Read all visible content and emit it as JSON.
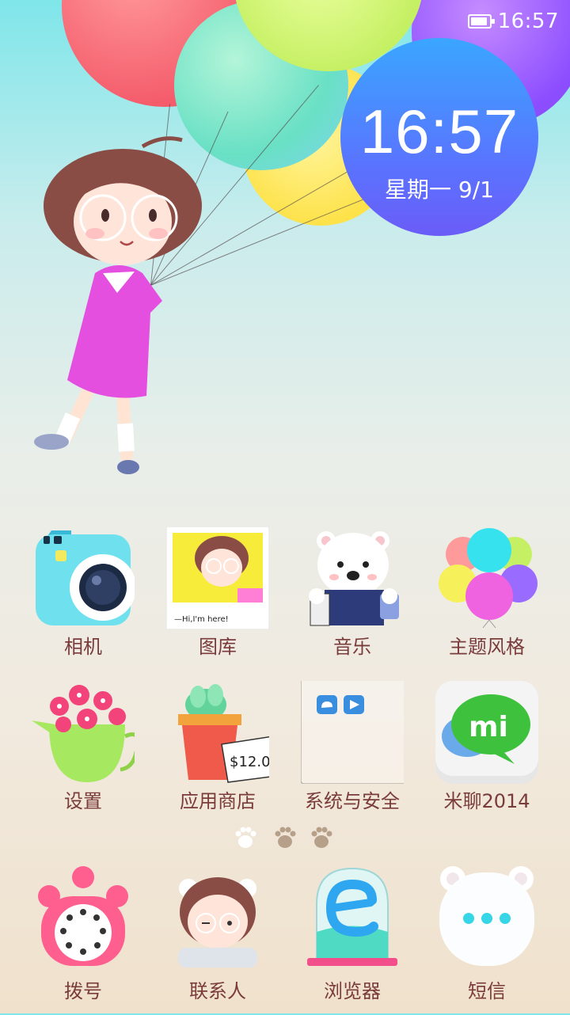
{
  "status_bar": {
    "time": "16:57",
    "battery_icon": "battery-icon",
    "battery_level": 0.9
  },
  "clock_widget": {
    "time": "16:57",
    "date": "星期一 9/1"
  },
  "apps": [
    {
      "label": "相机",
      "icon": "camera-icon"
    },
    {
      "label": "图库",
      "icon": "gallery-icon"
    },
    {
      "label": "音乐",
      "icon": "music-icon"
    },
    {
      "label": "主题风格",
      "icon": "theme-icon"
    },
    {
      "label": "设置",
      "icon": "settings-icon"
    },
    {
      "label": "应用商店",
      "icon": "app-store-icon"
    },
    {
      "label": "系统与安全",
      "icon": "system-security-folder-icon"
    },
    {
      "label": "米聊2014",
      "icon": "miliao-icon"
    }
  ],
  "gallery_caption": "—Hi,I'm here!",
  "price_tag": "$12.0",
  "miliao_logo": "mi",
  "page_indicator": {
    "pages": 3,
    "current": 1
  },
  "dock": [
    {
      "label": "拨号",
      "icon": "phone-icon"
    },
    {
      "label": "联系人",
      "icon": "contacts-icon"
    },
    {
      "label": "浏览器",
      "icon": "browser-icon"
    },
    {
      "label": "短信",
      "icon": "messages-icon"
    }
  ],
  "colors": {
    "label": "#7a3b3b",
    "clock_gradient_top": "#3aa6ff",
    "clock_gradient_bottom": "#6b5cf7"
  }
}
